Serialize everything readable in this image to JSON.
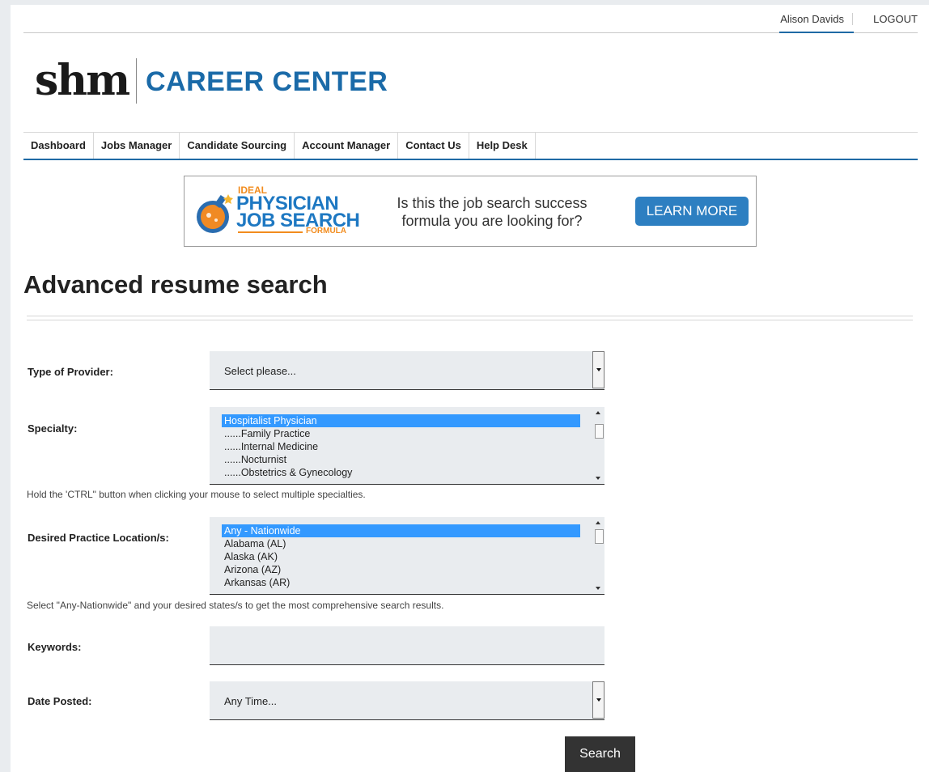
{
  "topbar": {
    "user_name": "Alison Davids",
    "logout_label": "LOGOUT"
  },
  "logo": {
    "brand": "shm",
    "subtitle": "CAREER CENTER"
  },
  "nav": {
    "items": [
      {
        "label": "Dashboard"
      },
      {
        "label": "Jobs Manager"
      },
      {
        "label": "Candidate Sourcing"
      },
      {
        "label": "Account Manager"
      },
      {
        "label": "Contact Us"
      },
      {
        "label": "Help Desk"
      }
    ]
  },
  "banner": {
    "ideal": "IDEAL",
    "physician": "PHYSICIAN",
    "job_search": "JOB SEARCH",
    "formula": "FORMULA",
    "tagline": "Is this the job search success formula you are looking for?",
    "button_label": "LEARN MORE"
  },
  "page_title": "Advanced resume search",
  "form": {
    "provider": {
      "label": "Type of Provider:",
      "value": "Select please..."
    },
    "specialty": {
      "label": "Specialty:",
      "options": [
        {
          "text": "Hospitalist Physician",
          "selected": true
        },
        {
          "text": "......Family Practice",
          "selected": false
        },
        {
          "text": "......Internal Medicine",
          "selected": false
        },
        {
          "text": "......Nocturnist",
          "selected": false
        },
        {
          "text": "......Obstetrics & Gynecology",
          "selected": false
        }
      ],
      "hint": "Hold the 'CTRL\" button when clicking your mouse to select multiple specialties."
    },
    "location": {
      "label": "Desired Practice Location/s:",
      "options": [
        {
          "text": "Any - Nationwide",
          "selected": true
        },
        {
          "text": "Alabama (AL)",
          "selected": false
        },
        {
          "text": "Alaska (AK)",
          "selected": false
        },
        {
          "text": "Arizona (AZ)",
          "selected": false
        },
        {
          "text": "Arkansas (AR)",
          "selected": false
        }
      ],
      "hint": "Select \"Any-Nationwide\" and your desired states/s to get the most comprehensive search results."
    },
    "keywords": {
      "label": "Keywords:",
      "value": ""
    },
    "date_posted": {
      "label": "Date Posted:",
      "value": "Any Time..."
    },
    "search_label": "Search"
  }
}
